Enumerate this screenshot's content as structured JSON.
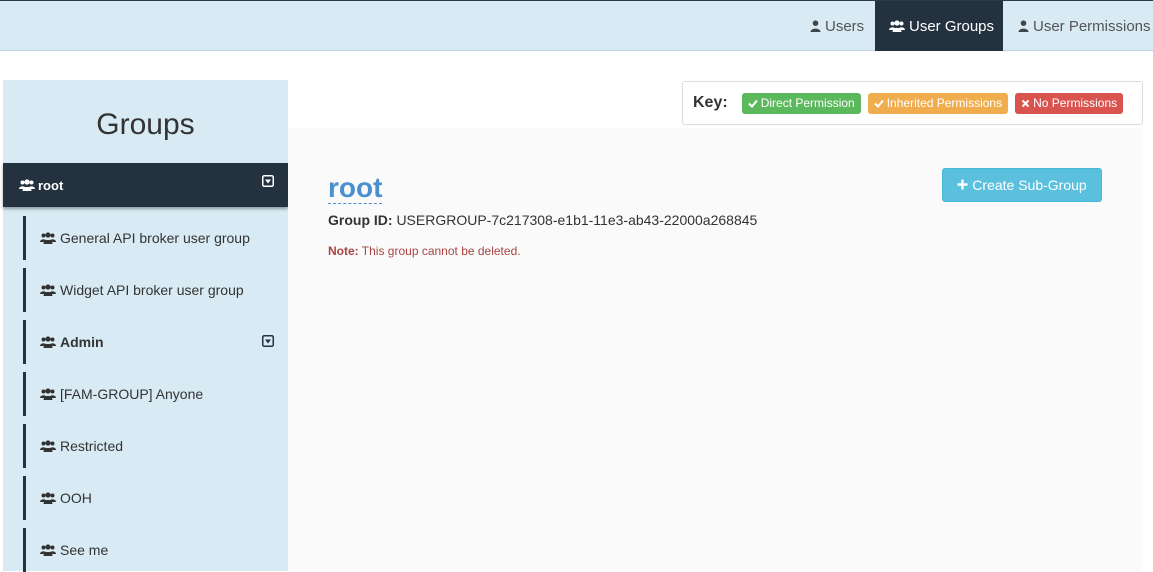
{
  "nav": {
    "users": "Users",
    "user_groups": "User Groups",
    "user_permissions": "User Permissions"
  },
  "sidebar": {
    "title": "Groups",
    "root": "root",
    "children": [
      "General API broker user group",
      "Widget API broker user group",
      "Admin",
      "[FAM-GROUP] Anyone",
      "Restricted",
      "OOH",
      "See me"
    ]
  },
  "key": {
    "label": "Key:",
    "direct": "Direct Permission",
    "inherited": "Inherited Permissions",
    "none": "No Permissions"
  },
  "main": {
    "title": "root",
    "group_id_label": "Group ID:",
    "group_id_value": "USERGROUP-7c217308-e1b1-11e3-ab43-22000a268845",
    "note_label": "Note:",
    "note_text": "This group cannot be deleted.",
    "create_button": "Create Sub-Group"
  },
  "colors": {
    "nav_bg": "#d8ebf5",
    "active_tab": "#243240",
    "direct": "#5cb85c",
    "inherited": "#f0ad4e",
    "none": "#d9534f",
    "create_button": "#5bc0de",
    "title_link": "#4a8fd0"
  }
}
